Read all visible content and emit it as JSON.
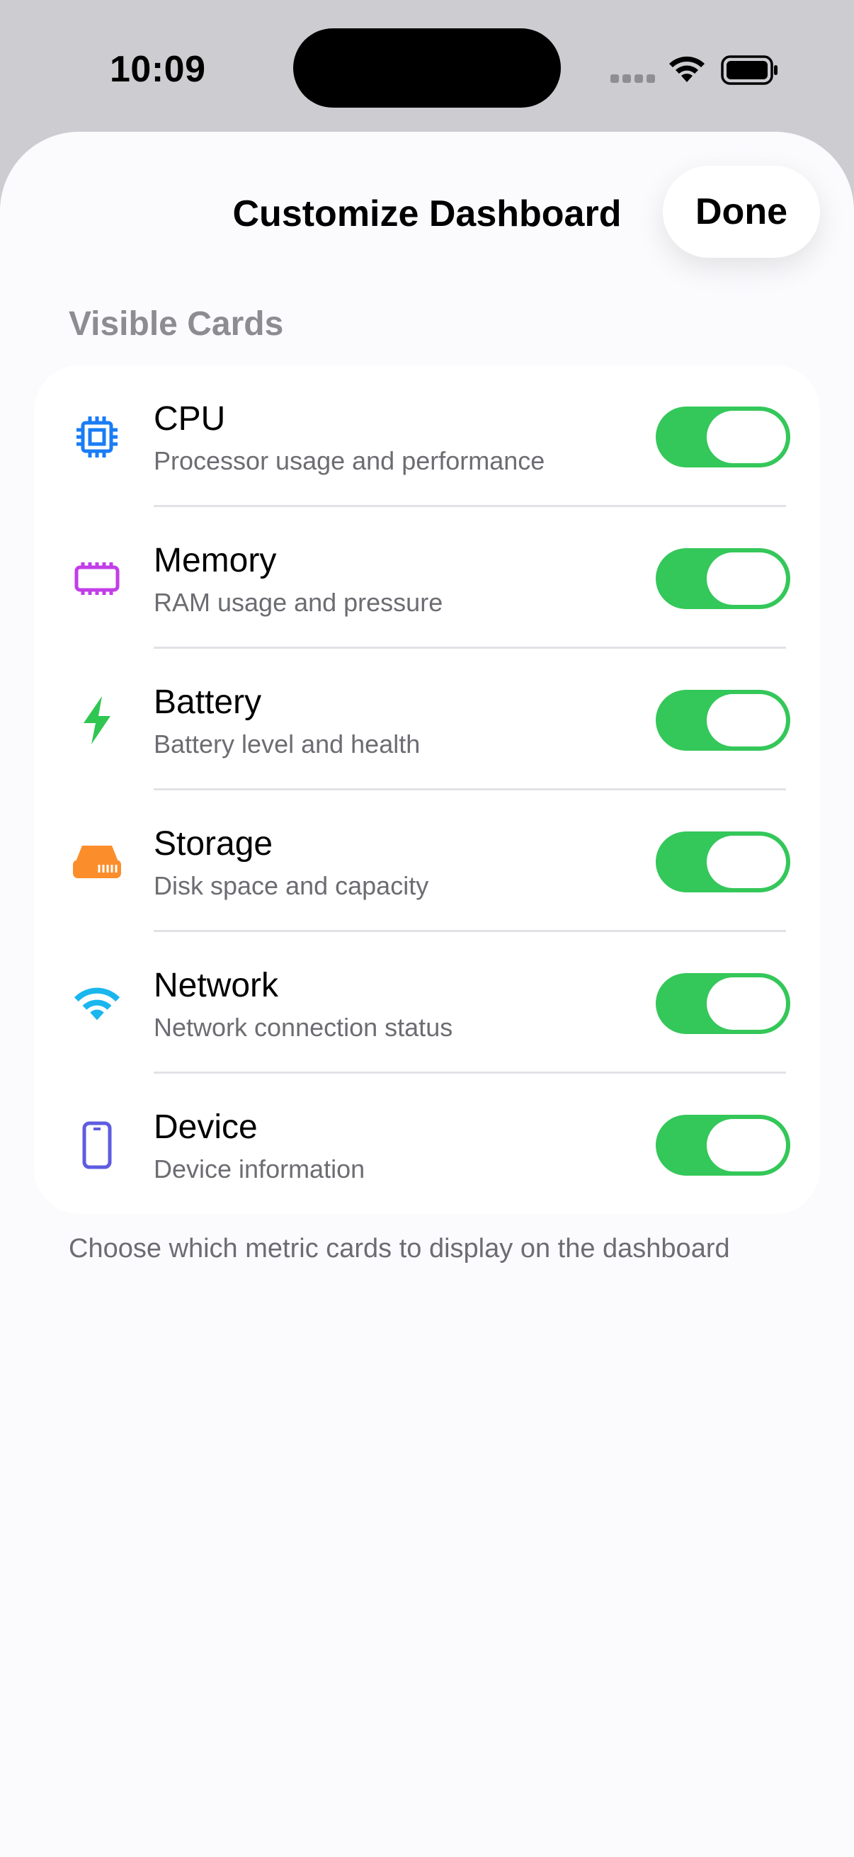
{
  "status_bar": {
    "time": "10:09"
  },
  "sheet": {
    "title": "Customize Dashboard",
    "done_label": "Done"
  },
  "section": {
    "header": "Visible Cards",
    "footer": "Choose which metric cards to display on the dashboard"
  },
  "cards": [
    {
      "title": "CPU",
      "subtitle": "Processor usage and performance",
      "icon": "cpu-icon",
      "color": "#1a7cf5",
      "enabled": true
    },
    {
      "title": "Memory",
      "subtitle": "RAM usage and pressure",
      "icon": "memory-icon",
      "color": "#c23ee8",
      "enabled": true
    },
    {
      "title": "Battery",
      "subtitle": "Battery level and health",
      "icon": "bolt-icon",
      "color": "#30c652",
      "enabled": true
    },
    {
      "title": "Storage",
      "subtitle": "Disk space and capacity",
      "icon": "drive-icon",
      "color": "#fb8e2b",
      "enabled": true
    },
    {
      "title": "Network",
      "subtitle": "Network connection status",
      "icon": "wifi-icon",
      "color": "#1ab6ee",
      "enabled": true
    },
    {
      "title": "Device",
      "subtitle": "Device information",
      "icon": "phone-icon",
      "color": "#5f5ce0",
      "enabled": true
    }
  ],
  "colors": {
    "toggle_on": "#34c759",
    "secondary_text": "#6c6c72"
  }
}
